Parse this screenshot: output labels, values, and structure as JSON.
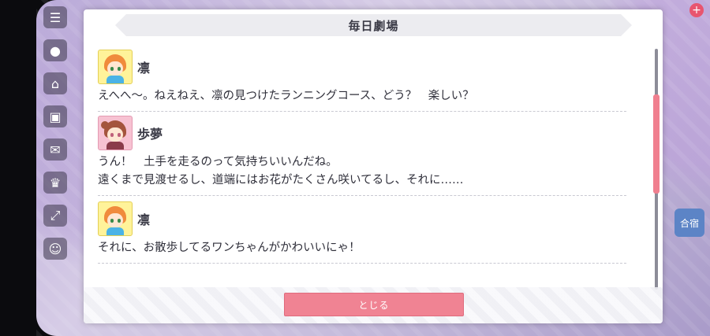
{
  "dialog": {
    "title": "毎日劇場",
    "close_label": "とじる"
  },
  "entries": [
    {
      "speaker": "凛",
      "avatar": "rin",
      "lines": [
        "えへへ〜。ねえねえ、凛の見つけたランニングコース、どう？　楽しい？"
      ]
    },
    {
      "speaker": "歩夢",
      "avatar": "ayumu",
      "lines": [
        "うん！　土手を走るのって気持ちいいんだね。",
        "遠くまで見渡せるし、道端にはお花がたくさん咲いてるし、それに……"
      ]
    },
    {
      "speaker": "凛",
      "avatar": "rin",
      "lines": [
        "それに、お散歩してるワンちゃんがかわいいにゃ！"
      ]
    }
  ],
  "background": {
    "side_menu_icons": [
      "menu-icon",
      "chat-icon",
      "shop-icon",
      "gift-icon",
      "mail-icon",
      "trophy-icon",
      "expand-icon",
      "profile-icon"
    ],
    "right_tag": "合宿"
  },
  "colors": {
    "accent_pink": "#f08393",
    "scroll_thumb": "#f07f8f",
    "rin_avatar_bg": "#fff39a",
    "ayumu_avatar_bg": "#f7c2d2"
  }
}
